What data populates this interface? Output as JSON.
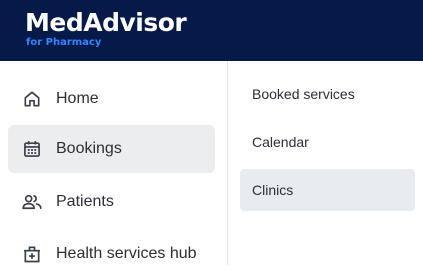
{
  "brand": {
    "name": "MedAdvisor",
    "subtitle": "for Pharmacy",
    "header_color": "#061a4a",
    "subtitle_color": "#2f86ff"
  },
  "sidebar": {
    "items": [
      {
        "label": "Home",
        "icon": "home-icon",
        "active": false
      },
      {
        "label": "Bookings",
        "icon": "calendar-icon",
        "active": true
      },
      {
        "label": "Patients",
        "icon": "people-icon",
        "active": false
      },
      {
        "label": "Health services hub",
        "icon": "health-services-icon",
        "active": false
      }
    ]
  },
  "subnav": {
    "items": [
      {
        "label": "Booked services",
        "active": false
      },
      {
        "label": "Calendar",
        "active": false
      },
      {
        "label": "Clinics",
        "active": true
      }
    ]
  }
}
